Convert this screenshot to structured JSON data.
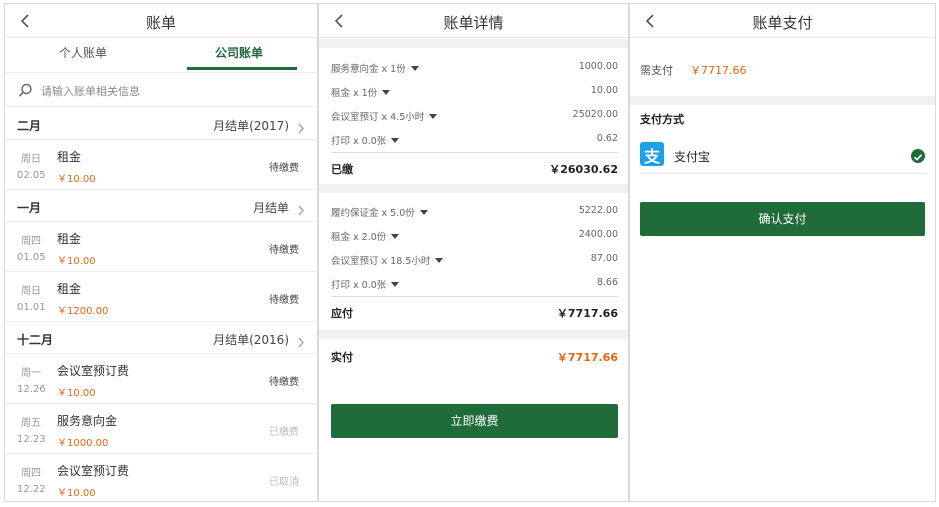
{
  "screens": {
    "list": {
      "title": "账单",
      "tabs": [
        "个人账单",
        "公司账单"
      ],
      "search_placeholder": "请输入账单相关信息",
      "groups": [
        {
          "month": "二月",
          "summary": "月结单(2017)",
          "items": [
            {
              "weekday": "周日",
              "date": "02.05",
              "name": "租金",
              "amount": "￥10.00",
              "status": "待缴费"
            }
          ]
        },
        {
          "month": "一月",
          "summary": "月结单",
          "items": [
            {
              "weekday": "周四",
              "date": "01.05",
              "name": "租金",
              "amount": "￥10.00",
              "status": "待缴费"
            },
            {
              "weekday": "周日",
              "date": "01.01",
              "name": "租金",
              "amount": "￥1200.00",
              "status": "待缴费"
            }
          ]
        },
        {
          "month": "十二月",
          "summary": "月结单(2016)",
          "items": [
            {
              "weekday": "周一",
              "date": "12.26",
              "name": "会议室预订费",
              "amount": "￥10.00",
              "status": "待缴费"
            },
            {
              "weekday": "周五",
              "date": "12.23",
              "name": "服务意向金",
              "amount": "￥1000.00",
              "status": "已缴费"
            },
            {
              "weekday": "周四",
              "date": "12.22",
              "name": "会议室预订费",
              "amount": "￥10.00",
              "status": "已取消"
            }
          ]
        }
      ]
    },
    "detail": {
      "title": "账单详情",
      "paid_section": [
        {
          "label": "服务意向金 x 1份",
          "value": "1000.00"
        },
        {
          "label": "租金 x 1份",
          "value": "10.00"
        },
        {
          "label": "会议室预订 x 4.5小时",
          "value": "25020.00"
        },
        {
          "label": "打印 x 0.0张",
          "value": "0.62"
        }
      ],
      "paid_total": {
        "label": "已缴",
        "value": "￥26030.62"
      },
      "due_section": [
        {
          "label": "履约保证金 x 5.0份",
          "value": "5222.00"
        },
        {
          "label": "租金 x 2.0份",
          "value": "2400.00"
        },
        {
          "label": "会议室预订 x 18.5小时",
          "value": "87.00"
        },
        {
          "label": "打印 x 0.0张",
          "value": "8.66"
        }
      ],
      "due_total": {
        "label": "应付",
        "value": "￥7717.66"
      },
      "actual": {
        "label": "实付",
        "value": "￥7717.66"
      },
      "pay_button": "立即缴费"
    },
    "payment": {
      "title": "账单支付",
      "need_label": "需支付",
      "need_amount": "￥7717.66",
      "method_title": "支付方式",
      "method_name": "支付宝",
      "method_logo_char": "支",
      "confirm_button": "确认支付"
    }
  },
  "colors": {
    "brand_green": "#1f6b3a",
    "amount_orange": "#e8650f",
    "alipay_blue": "#1ea0e6"
  }
}
